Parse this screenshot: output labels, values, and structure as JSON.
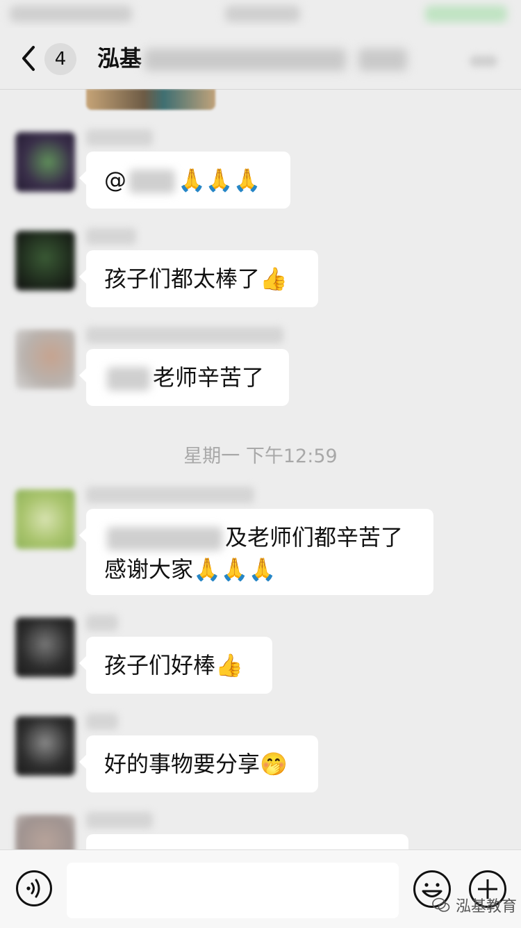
{
  "header": {
    "unread_count": "4",
    "title": "泓基"
  },
  "messages": [
    {
      "text_prefix": "@",
      "text": "",
      "emoji": "🙏🙏🙏"
    },
    {
      "text": "孩子们都太棒了",
      "emoji": "👍"
    },
    {
      "text": "老师辛苦了",
      "emoji": ""
    },
    {
      "text": "及老师们都辛苦了",
      "text_line2": "感谢大家",
      "emoji": "🙏🙏🙏"
    },
    {
      "text": "孩子们好棒",
      "emoji": "👍"
    },
    {
      "text": "好的事物要分享",
      "emoji": "🤭"
    }
  ],
  "timestamp": "星期一 下午12:59",
  "input": {
    "placeholder": ""
  },
  "watermark": "泓基教育",
  "icons": {
    "back": "chevron-left-icon",
    "voice": "voice-icon",
    "emoji": "emoji-face-icon",
    "plus": "plus-circle-icon",
    "watermark": "wechat-logo-icon"
  },
  "colors": {
    "background": "#ededed",
    "bubble": "#ffffff",
    "timestamp": "#a8a8a8"
  }
}
